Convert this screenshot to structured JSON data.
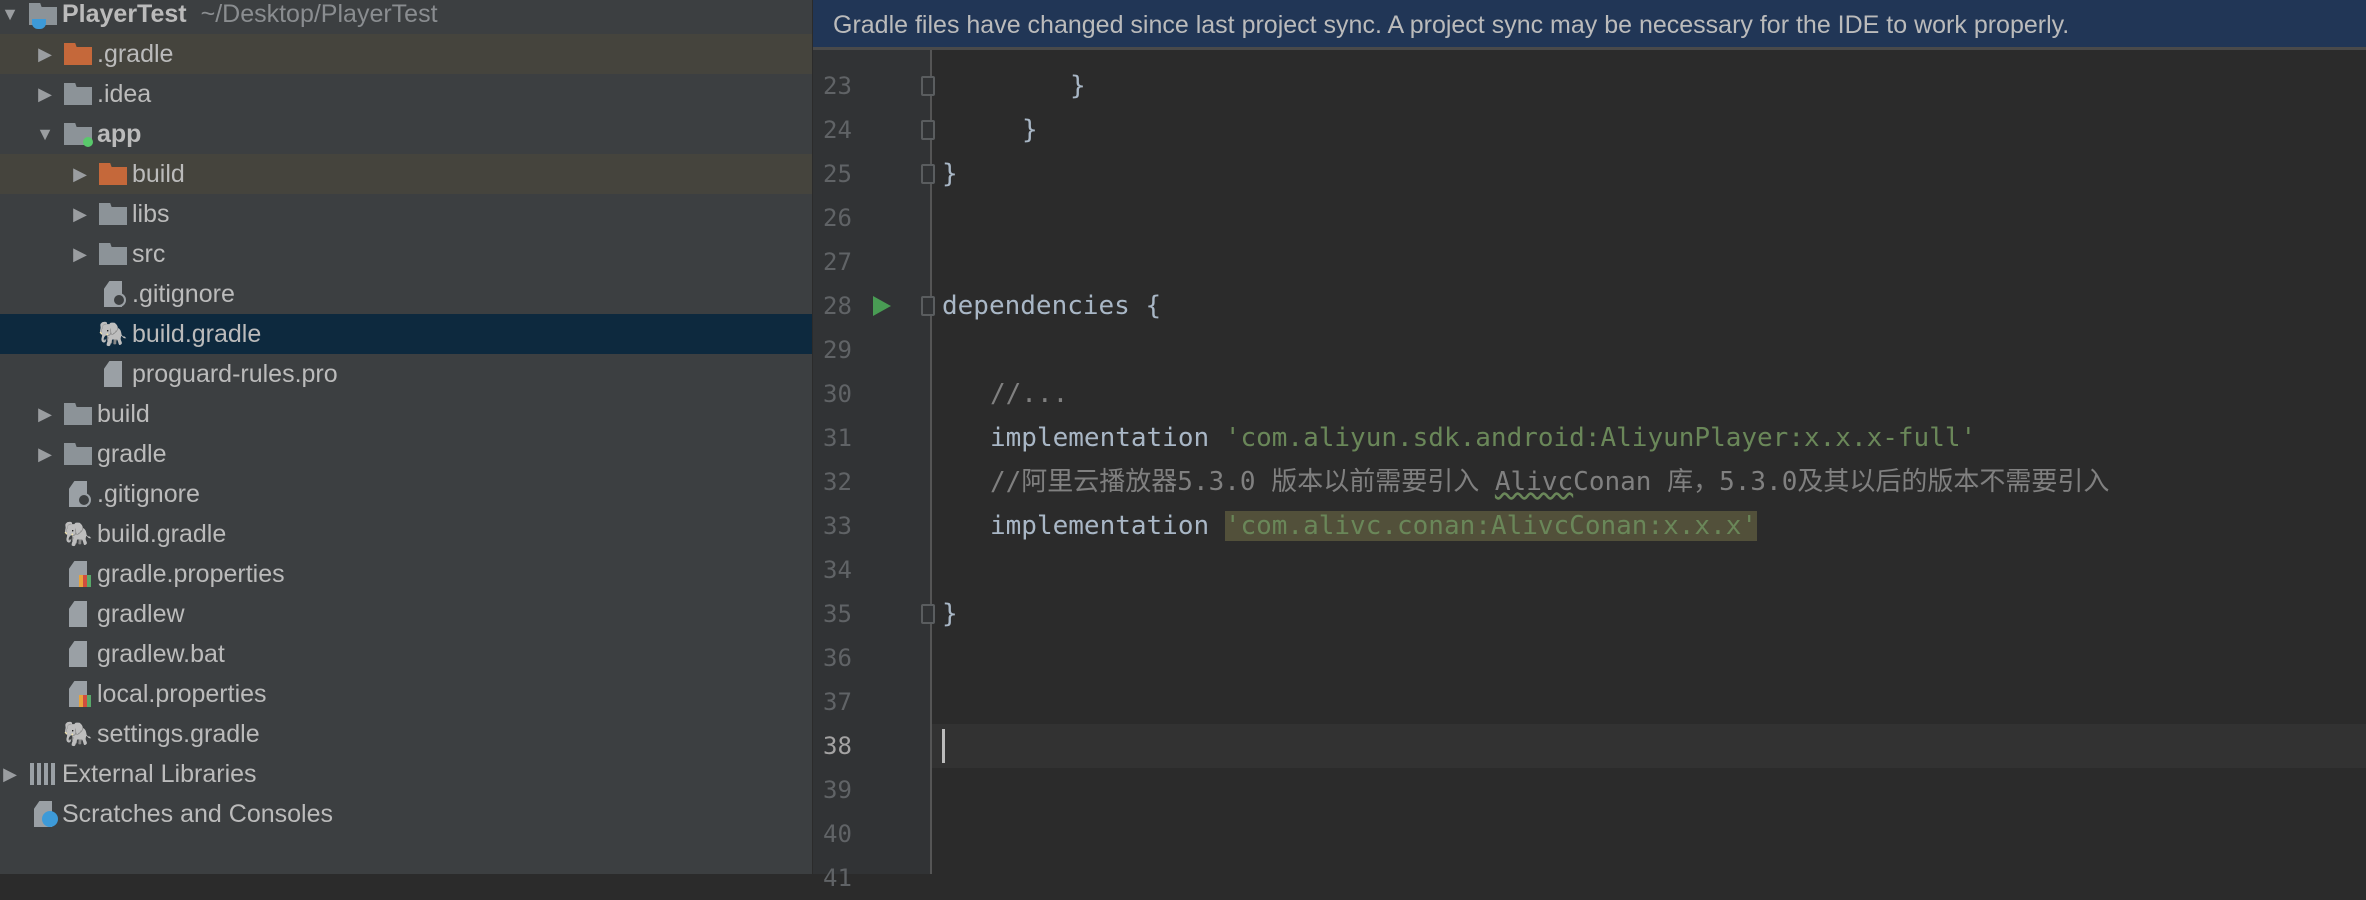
{
  "project_tree": {
    "root": {
      "name": "PlayerTest",
      "path": "~/Desktop/PlayerTest"
    },
    "items": [
      {
        "name": ".gradle",
        "type": "folder-excluded",
        "expanded": false,
        "level": 1
      },
      {
        "name": ".idea",
        "type": "folder",
        "expanded": false,
        "level": 1
      },
      {
        "name": "app",
        "type": "module",
        "expanded": true,
        "level": 1
      },
      {
        "name": "build",
        "type": "folder-excluded",
        "expanded": false,
        "level": 2
      },
      {
        "name": "libs",
        "type": "folder",
        "expanded": false,
        "level": 2
      },
      {
        "name": "src",
        "type": "folder",
        "expanded": false,
        "level": 2
      },
      {
        "name": ".gitignore",
        "type": "ignore-file",
        "level": 2
      },
      {
        "name": "build.gradle",
        "type": "gradle-file",
        "level": 2,
        "selected": true
      },
      {
        "name": "proguard-rules.pro",
        "type": "file",
        "level": 2
      },
      {
        "name": "build",
        "type": "folder",
        "expanded": false,
        "level": 1
      },
      {
        "name": "gradle",
        "type": "folder",
        "expanded": false,
        "level": 1
      },
      {
        "name": ".gitignore",
        "type": "ignore-file",
        "level": 1
      },
      {
        "name": "build.gradle",
        "type": "gradle-file",
        "level": 1
      },
      {
        "name": "gradle.properties",
        "type": "properties-file",
        "level": 1
      },
      {
        "name": "gradlew",
        "type": "file",
        "level": 1
      },
      {
        "name": "gradlew.bat",
        "type": "file",
        "level": 1
      },
      {
        "name": "local.properties",
        "type": "properties-file",
        "level": 1
      },
      {
        "name": "settings.gradle",
        "type": "gradle-file",
        "level": 1
      },
      {
        "name": "External Libraries",
        "type": "libraries",
        "expanded": false,
        "level": 0
      },
      {
        "name": "Scratches and Consoles",
        "type": "scratches",
        "level": 0
      }
    ]
  },
  "banner": {
    "text": "Gradle files have changed since last project sync. A project sync may be necessary for the IDE to work properly."
  },
  "editor": {
    "current_line": "38",
    "lines": [
      {
        "n": "23",
        "text": "}"
      },
      {
        "n": "24",
        "text": "}"
      },
      {
        "n": "25",
        "text": "}"
      },
      {
        "n": "26",
        "text": ""
      },
      {
        "n": "27",
        "text": ""
      },
      {
        "n": "28",
        "text": "dependencies {"
      },
      {
        "n": "29",
        "text": ""
      },
      {
        "n": "30",
        "text": "//..."
      },
      {
        "n": "31",
        "kw": "implementation ",
        "str": "'com.aliyun.sdk.android:AliyunPlayer:x.x.x-full'"
      },
      {
        "n": "32",
        "pre": "//阿里云播放器5.3.0 版本以前需要引入 ",
        "squig": "Alivc",
        "post": "Conan 库，5.3.0及其以后的版本不需要引入"
      },
      {
        "n": "33",
        "kw": "implementation ",
        "str": "'com.alivc.conan:AlivcConan:x.x.x'"
      },
      {
        "n": "34",
        "text": ""
      },
      {
        "n": "35",
        "text": "}"
      },
      {
        "n": "36",
        "text": ""
      },
      {
        "n": "37",
        "text": ""
      },
      {
        "n": "38",
        "text": ""
      },
      {
        "n": "39",
        "text": ""
      },
      {
        "n": "40",
        "text": ""
      },
      {
        "n": "41",
        "text": ""
      }
    ]
  },
  "colors": {
    "accent_selection": "#0d293e",
    "banner": "#213656",
    "string": "#6a8759",
    "run_icon": "#499c54",
    "excluded_folder": "#c5683a"
  }
}
